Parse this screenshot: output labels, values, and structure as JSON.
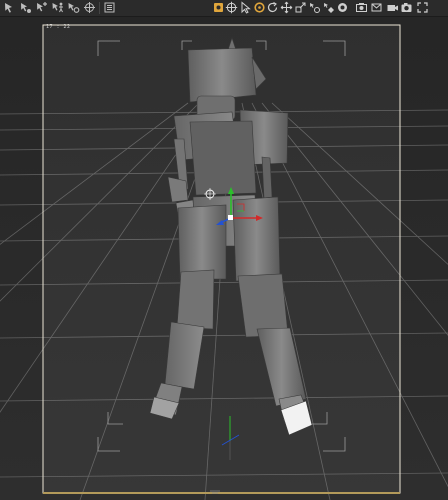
{
  "viewport": {
    "frame_label": "17 : 22",
    "background": "#262626",
    "frame_fill": "#ffffff",
    "frame_border": "#b39a5a",
    "grid_color": "#6d6d6d",
    "figure_color": "#7c7c7c"
  },
  "toolbar": {
    "left_tools": [
      {
        "icon": "object-select-icon",
        "color": "#bdbdbd"
      },
      {
        "icon": "node-select-icon",
        "color": "#bdbdbd"
      },
      {
        "icon": "bone-select-icon",
        "color": "#bdbdbd"
      },
      {
        "icon": "pose-select-icon",
        "color": "#bdbdbd"
      },
      {
        "icon": "joint-edit-icon",
        "color": "#bdbdbd"
      },
      {
        "icon": "transform-icon",
        "color": "#bdbdbd"
      },
      {
        "icon": "menu-list-icon",
        "color": "#bdbdbd"
      }
    ],
    "right_tools": [
      {
        "icon": "active-pose-icon",
        "color": "#e0a63c"
      },
      {
        "icon": "universal-tool-icon",
        "color": "#cfcfcf"
      },
      {
        "icon": "pointer-icon",
        "color": "#cfcfcf"
      },
      {
        "icon": "rotate-tool-icon",
        "color": "#e0a63c"
      },
      {
        "icon": "refresh-icon",
        "color": "#cfcfcf"
      },
      {
        "icon": "translate-tool-icon",
        "color": "#cfcfcf"
      },
      {
        "icon": "scale-tool-icon",
        "color": "#cfcfcf"
      },
      {
        "icon": "node-weight-icon",
        "color": "#cfcfcf"
      },
      {
        "icon": "surface-selection-icon",
        "color": "#cfcfcf"
      },
      {
        "icon": "spot-render-icon",
        "color": "#cfcfcf"
      },
      {
        "icon": "render-icon",
        "color": "#cfcfcf"
      },
      {
        "icon": "geometry-editor-icon",
        "color": "#cfcfcf"
      },
      {
        "icon": "camera-icon",
        "color": "#cfcfcf"
      },
      {
        "icon": "snapshot-icon",
        "color": "#cfcfcf"
      },
      {
        "icon": "expand-icon",
        "color": "#cfcfcf"
      }
    ]
  }
}
